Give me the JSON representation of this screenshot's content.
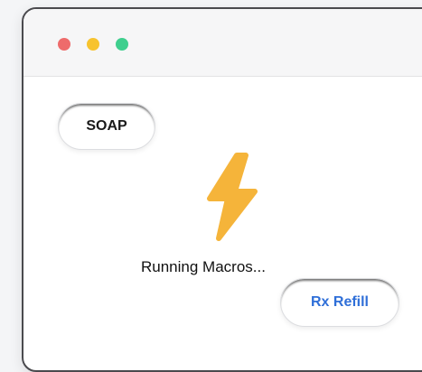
{
  "window": {
    "controls": {
      "close_color": "#ee6b6b",
      "minimize_color": "#f7c32e",
      "maximize_color": "#3fcf8e"
    }
  },
  "buttons": {
    "soap_label": "SOAP",
    "rx_refill_label": "Rx Refill",
    "rx_refill_color": "#2f6fd8"
  },
  "status": {
    "icon": "lightning-bolt-icon",
    "icon_color": "#f5b43a",
    "text": "Running Macros..."
  }
}
